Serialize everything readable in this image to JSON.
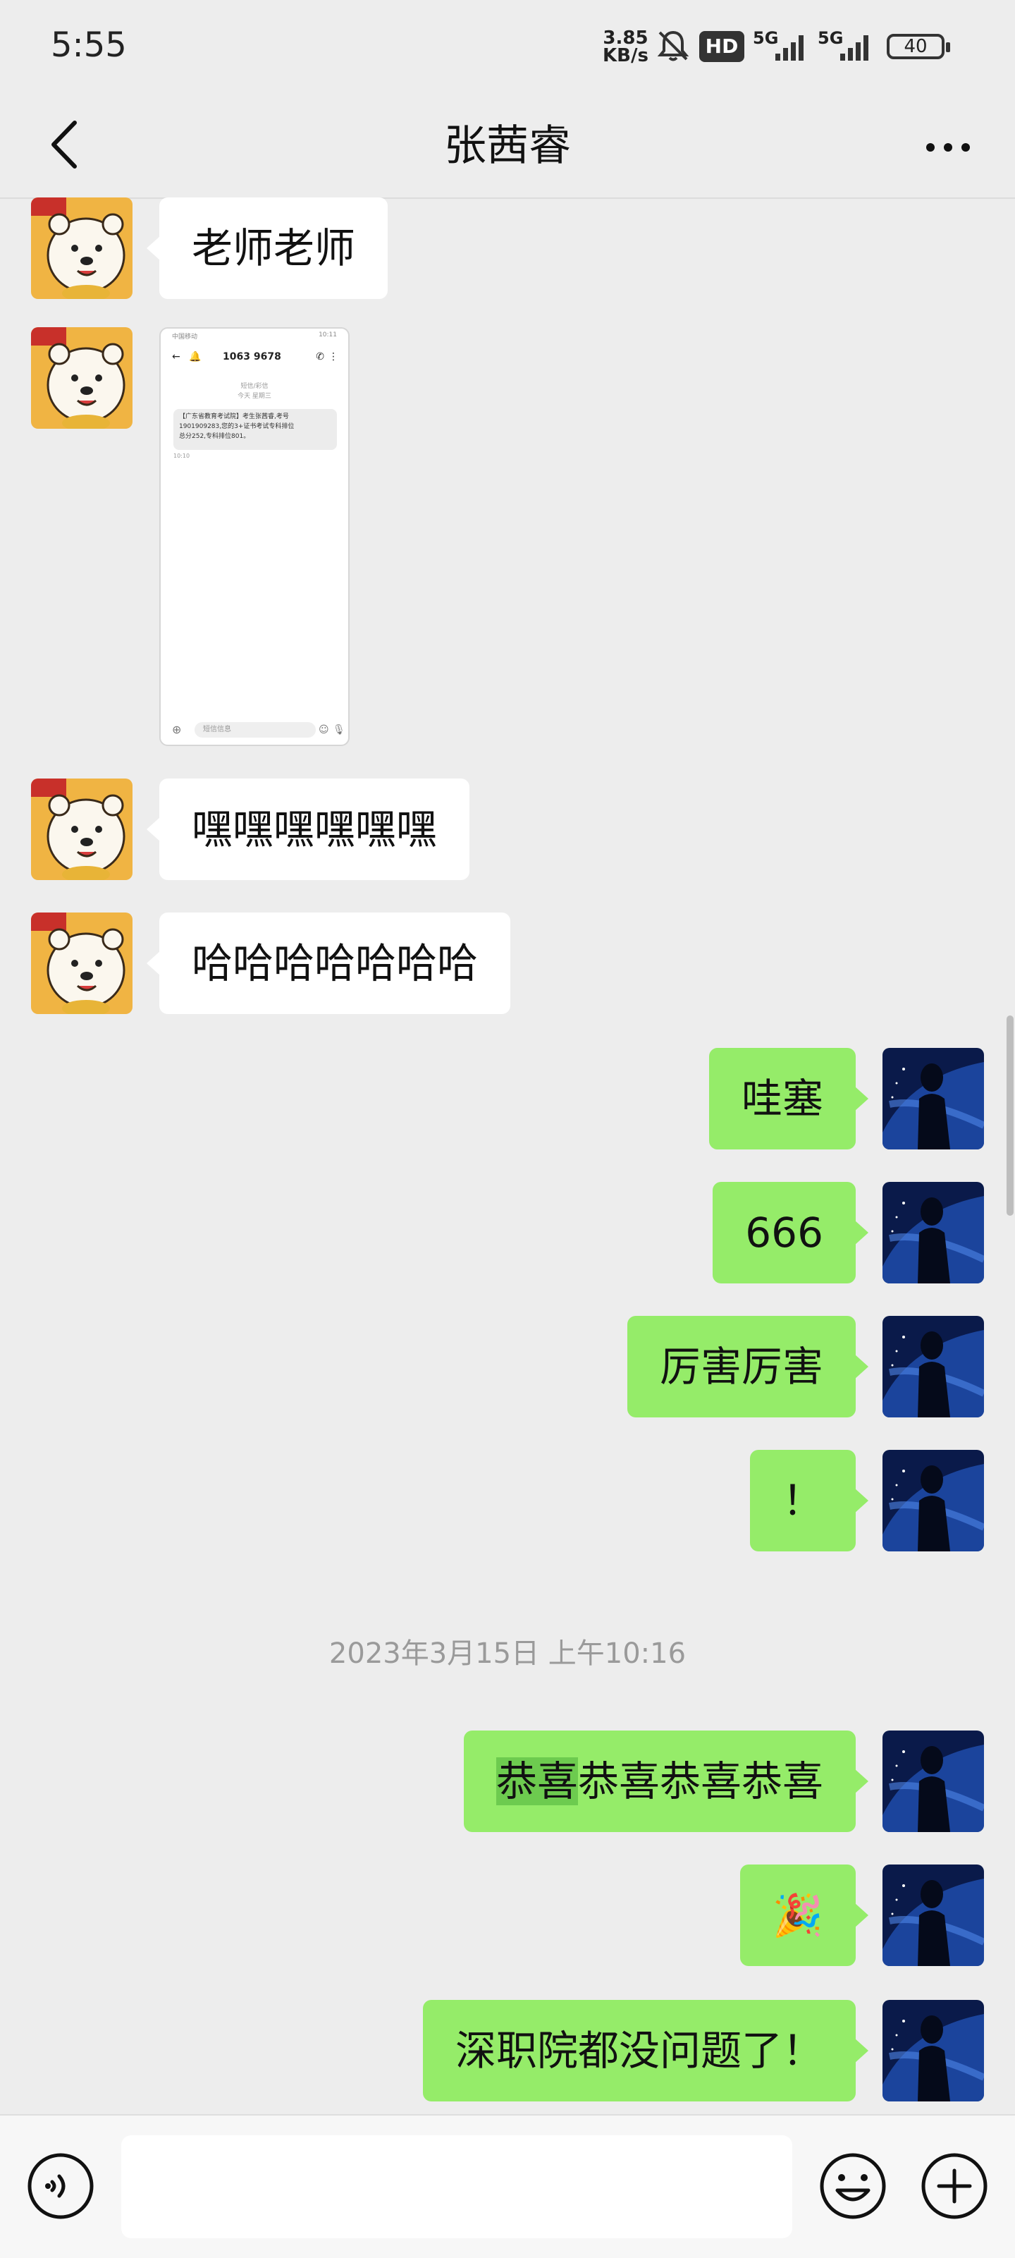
{
  "status_bar": {
    "time": "5:55",
    "net_speed_value": "3.85",
    "net_speed_unit": "KB/s",
    "hd_label": "HD",
    "signal1_label": "5G",
    "signal2_label": "5G",
    "battery": "40"
  },
  "header": {
    "title": "张茜睿"
  },
  "messages": [
    {
      "side": "in",
      "text": "老师老师"
    },
    {
      "side": "in",
      "type": "image",
      "screenshot": {
        "status_left": "中国移动",
        "status_right": "10:11",
        "number": "1063 9678",
        "sub1": "短信/彩信",
        "sub2": "今天 星期三",
        "sms_line1": "【广东省教育考试院】考生张茜睿,考号",
        "sms_line2": "1901909283,您的3+证书考试专科排位",
        "sms_line3": "总分252,专科排位801。",
        "sms_time": "10:10",
        "input_placeholder": "短信信息"
      }
    },
    {
      "side": "in",
      "text": "嘿嘿嘿嘿嘿嘿"
    },
    {
      "side": "in",
      "text": "哈哈哈哈哈哈哈"
    },
    {
      "side": "out",
      "text": "哇塞"
    },
    {
      "side": "out",
      "text": "666"
    },
    {
      "side": "out",
      "text": "厉害厉害"
    },
    {
      "side": "out",
      "text": "！"
    },
    {
      "side": "out",
      "text_highlight": "恭喜",
      "text_rest": "恭喜恭喜恭喜"
    },
    {
      "side": "out",
      "text": "🎉"
    },
    {
      "side": "out",
      "text": "深职院都没问题了！"
    }
  ],
  "timestamp": "2023年3月15日 上午10:16",
  "colors": {
    "background": "#ededed",
    "bubble_out": "#95ec69",
    "bubble_in": "#ffffff",
    "highlight": "#6dcb4f"
  },
  "icons": {
    "back": "chevron-left-icon",
    "more": "more-dots-icon",
    "voice": "voice-icon",
    "emoji": "emoji-icon",
    "plus": "plus-icon"
  }
}
